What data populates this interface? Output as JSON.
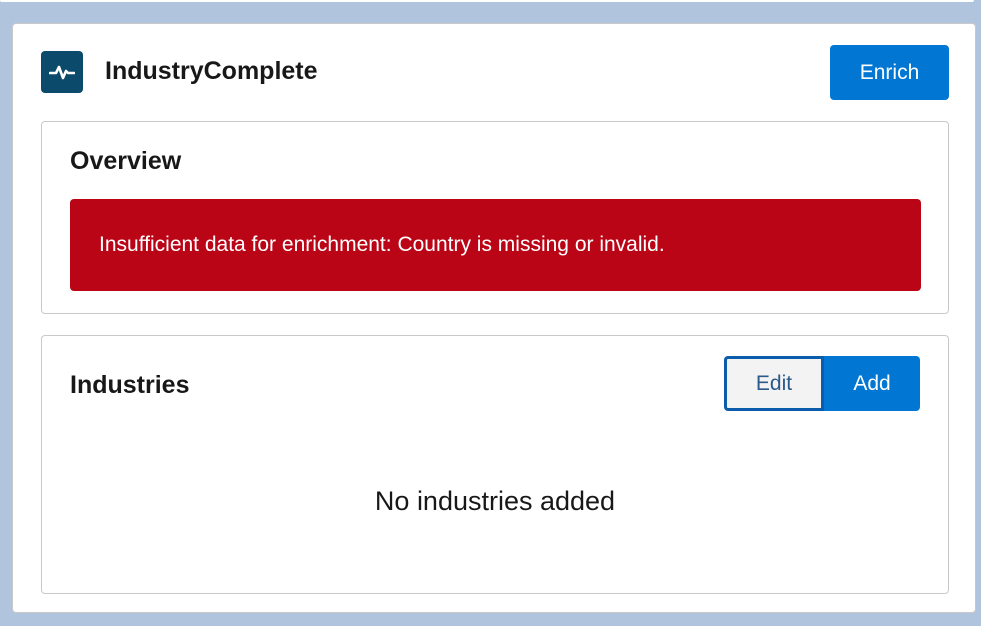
{
  "header": {
    "title": "IndustryComplete",
    "icon": "activity-pulse-icon",
    "enrich_label": "Enrich"
  },
  "overview": {
    "title": "Overview",
    "error_message": "Insufficient data for enrichment: Country is missing or invalid."
  },
  "industries": {
    "title": "Industries",
    "edit_label": "Edit",
    "add_label": "Add",
    "empty_message": "No industries added"
  },
  "colors": {
    "brand": "#0176d3",
    "error": "#ba0517",
    "icon_bg": "#0b4a6a",
    "page_bg": "#b0c4de"
  }
}
